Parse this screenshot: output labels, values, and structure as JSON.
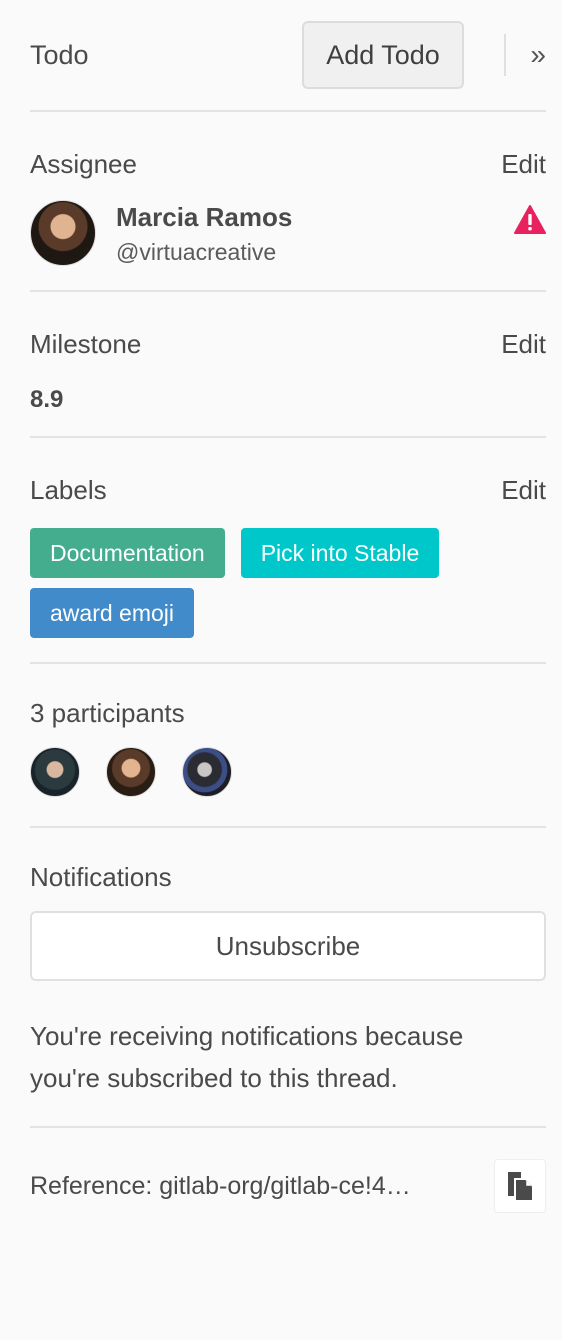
{
  "todo": {
    "title": "Todo",
    "add_label": "Add Todo",
    "collapse_icon": "double-chevron-right-icon",
    "collapse_glyph": "»"
  },
  "assignee": {
    "title": "Assignee",
    "edit": "Edit",
    "name": "Marcia Ramos",
    "username": "@virtuacreative",
    "warning_icon": "warning-triangle-icon",
    "warning_color": "#e8215f"
  },
  "milestone": {
    "title": "Milestone",
    "edit": "Edit",
    "value": "8.9"
  },
  "labels": {
    "title": "Labels",
    "edit": "Edit",
    "items": [
      {
        "text": "Documentation",
        "color": "#44ad8e"
      },
      {
        "text": "Pick into Stable",
        "color": "#00c8ca"
      },
      {
        "text": "award emoji",
        "color": "#428bca"
      }
    ]
  },
  "participants": {
    "title": "3 participants"
  },
  "notifications": {
    "title": "Notifications",
    "button": "Unsubscribe",
    "description": "You're receiving notifications because you're subscribed to this thread."
  },
  "reference": {
    "text": "Reference: gitlab-org/gitlab-ce!4…",
    "copy_icon": "copy-clipboard-icon"
  }
}
